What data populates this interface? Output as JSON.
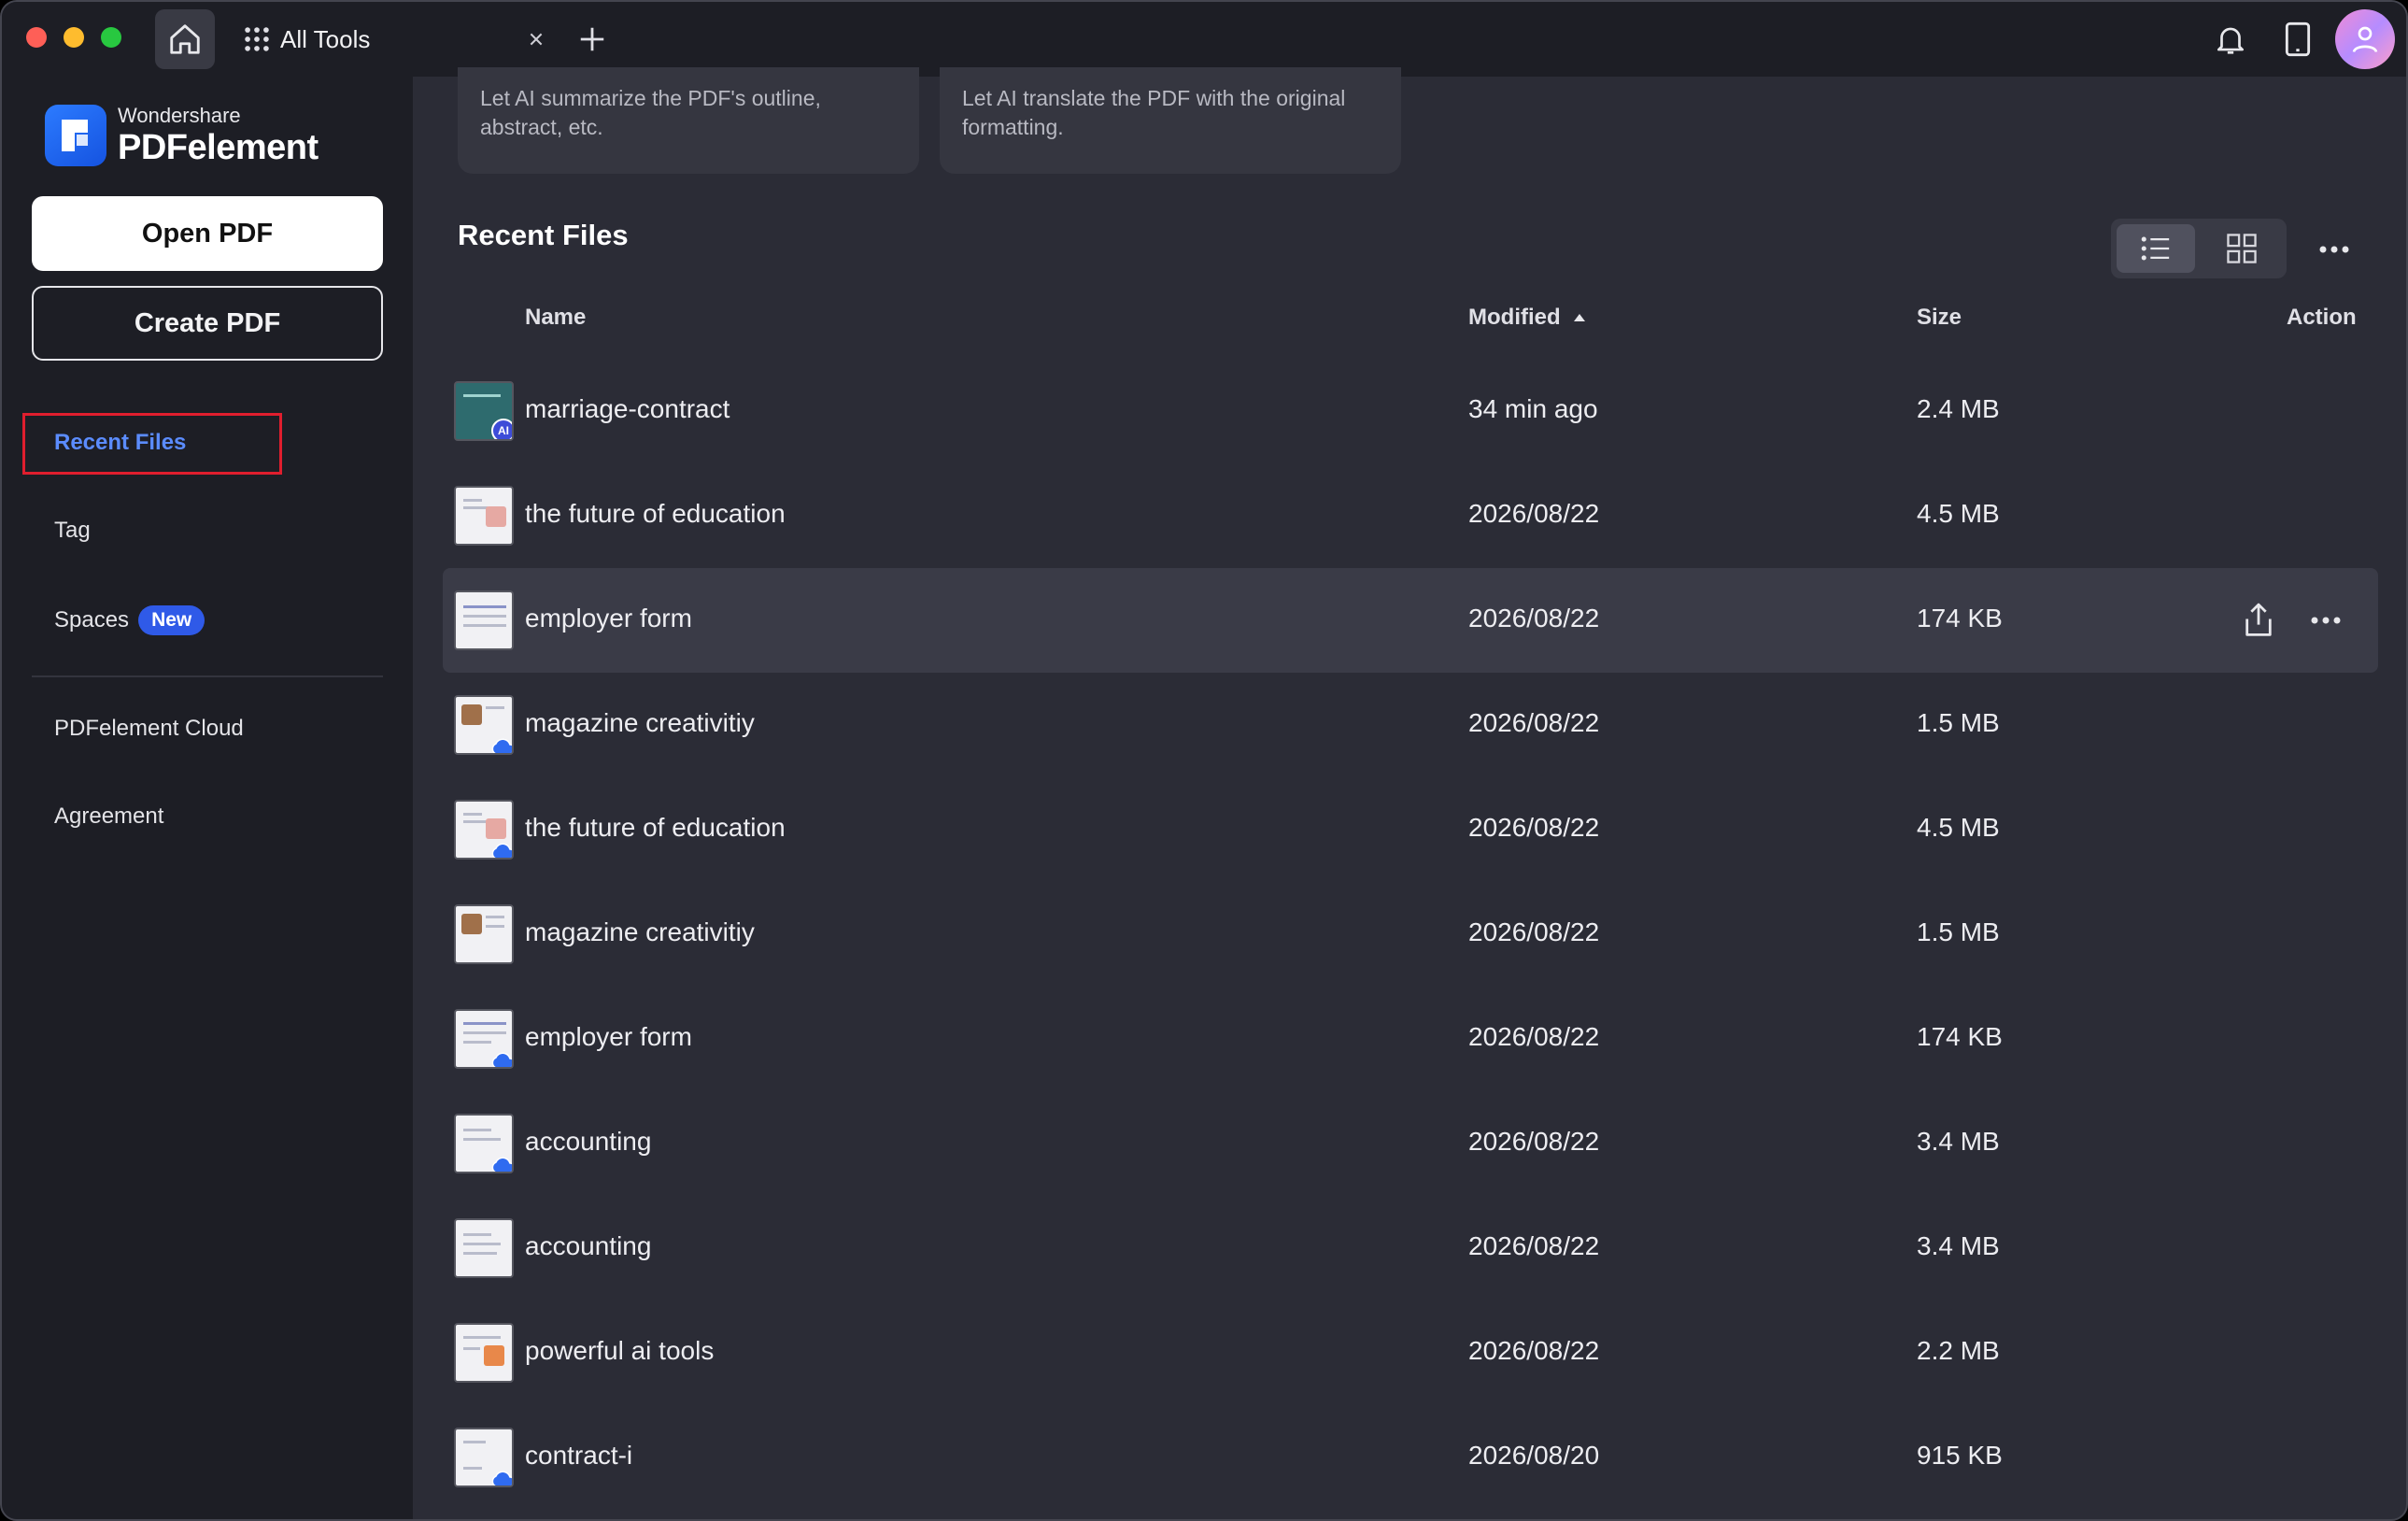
{
  "titlebar": {
    "tab_label": "All Tools"
  },
  "sidebar": {
    "brand": "Wondershare",
    "product": "PDFelement",
    "open_pdf": "Open PDF",
    "create_pdf": "Create PDF",
    "nav": {
      "recent_files": "Recent Files",
      "tag": "Tag",
      "spaces": "Spaces",
      "spaces_badge": "New",
      "cloud": "PDFelement Cloud",
      "agreement": "Agreement"
    }
  },
  "cards": [
    {
      "description": "Let AI summarize the PDF's outline, abstract, etc."
    },
    {
      "description": "Let AI translate the PDF with the original formatting."
    }
  ],
  "main": {
    "section_title": "Recent Files",
    "columns": {
      "name": "Name",
      "modified": "Modified",
      "size": "Size",
      "action": "Action"
    },
    "files": [
      {
        "name": "marriage-contract",
        "modified": "34 min ago",
        "size": "2.4 MB"
      },
      {
        "name": "the future of education",
        "modified": "2026/08/22",
        "size": "4.5 MB"
      },
      {
        "name": "employer form",
        "modified": "2026/08/22",
        "size": "174 KB"
      },
      {
        "name": "magazine creativitiy",
        "modified": "2026/08/22",
        "size": "1.5 MB"
      },
      {
        "name": "the future of education",
        "modified": "2026/08/22",
        "size": "4.5 MB"
      },
      {
        "name": "magazine creativitiy",
        "modified": "2026/08/22",
        "size": "1.5 MB"
      },
      {
        "name": "employer form",
        "modified": "2026/08/22",
        "size": "174 KB"
      },
      {
        "name": "accounting",
        "modified": "2026/08/22",
        "size": "3.4 MB"
      },
      {
        "name": "accounting",
        "modified": "2026/08/22",
        "size": "3.4 MB"
      },
      {
        "name": "powerful ai tools",
        "modified": "2026/08/22",
        "size": "2.2 MB"
      },
      {
        "name": "contract-i",
        "modified": "2026/08/20",
        "size": "915 KB"
      }
    ]
  },
  "colors": {
    "accent": "#5b8cff",
    "badge": "#2f5ae8",
    "highlight_box": "#e01e2e",
    "background": "#2b2c36",
    "sidebar": "#1d1e25"
  },
  "icons": [
    "home-icon",
    "apps-grid-icon",
    "close-icon",
    "plus-icon",
    "bell-icon",
    "tablet-icon",
    "avatar-icon",
    "list-view-icon",
    "grid-view-icon",
    "more-icon",
    "sort-ascending-icon",
    "share-icon",
    "cloud-icon",
    "ai-icon"
  ]
}
